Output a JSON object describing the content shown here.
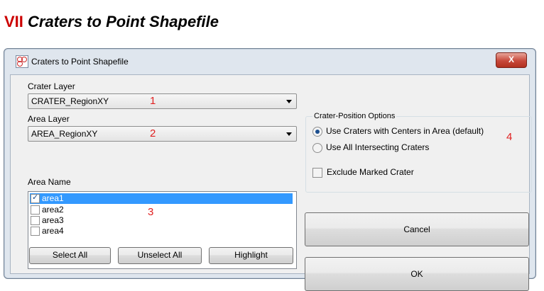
{
  "heading": {
    "roman": "VII",
    "text": "Craters to Point Shapefile"
  },
  "window": {
    "title": "Craters to Point Shapefile",
    "close_glyph": "X"
  },
  "crater_layer": {
    "label": "Crater Layer",
    "value": "CRATER_RegionXY"
  },
  "area_layer": {
    "label": "Area Layer",
    "value": "AREA_RegionXY"
  },
  "area_name": {
    "label": "Area Name",
    "items": [
      {
        "label": "area1",
        "checked": true,
        "selected": true
      },
      {
        "label": "area2",
        "checked": false,
        "selected": false
      },
      {
        "label": "area3",
        "checked": false,
        "selected": false
      },
      {
        "label": "area4",
        "checked": false,
        "selected": false
      }
    ]
  },
  "buttons": {
    "select_all": "Select All",
    "unselect_all": "Unselect All",
    "highlight": "Highlight",
    "cancel": "Cancel",
    "ok": "OK"
  },
  "options": {
    "title": "Crater-Position Options",
    "radio_centers": "Use Craters with Centers in Area (default)",
    "radio_intersecting": "Use All Intersecting Craters",
    "selected_radio": "radio_centers",
    "exclude_marked": "Exclude Marked Crater",
    "exclude_checked": false
  },
  "annotations": [
    "1",
    "2",
    "3",
    "4"
  ],
  "colors": {
    "annotation": "#e02020",
    "heading_roman": "#cc0000",
    "selection": "#3399ff"
  }
}
